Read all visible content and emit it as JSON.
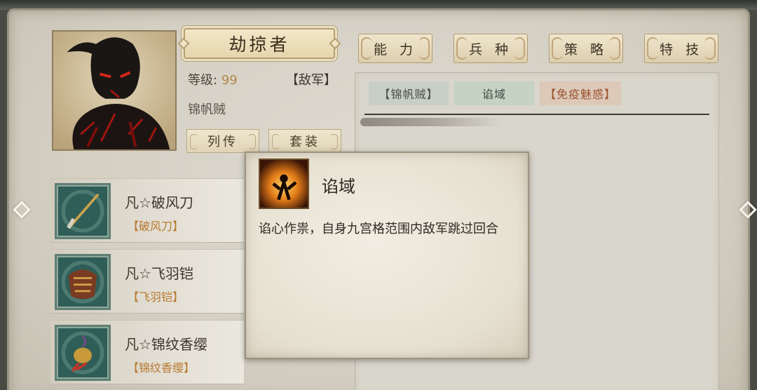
{
  "character": {
    "name": "劫掠者",
    "level_label": "等级:",
    "level_value": "99",
    "faction": "【敌军】",
    "troop": "锦帆贼",
    "buttons": {
      "biography": "列传",
      "set": "套装"
    }
  },
  "tabs": [
    "能 力",
    "兵 种",
    "策 略",
    "特 技"
  ],
  "skill_tags": [
    "【锦帆贼】",
    "谄域",
    "【免疫魅惑】"
  ],
  "equipment": [
    {
      "name": "凡☆破风刀",
      "sub": "【破风刀】",
      "icon": "blade-icon"
    },
    {
      "name": "凡☆飞羽铠",
      "sub": "【飞羽铠】",
      "icon": "armor-icon"
    },
    {
      "name": "凡☆锦纹香缨",
      "sub": "【锦纹香缨】",
      "icon": "sachet-icon"
    }
  ],
  "tooltip": {
    "title": "谄域",
    "description": "谄心作祟，自身九宫格范围内敌军跳过回合",
    "icon": "fire-warrior-icon"
  },
  "colors": {
    "parchment": "#dedad0",
    "gold_text": "#b08a4a",
    "orange_text": "#b8792e",
    "tag_red": "#9a5232"
  }
}
